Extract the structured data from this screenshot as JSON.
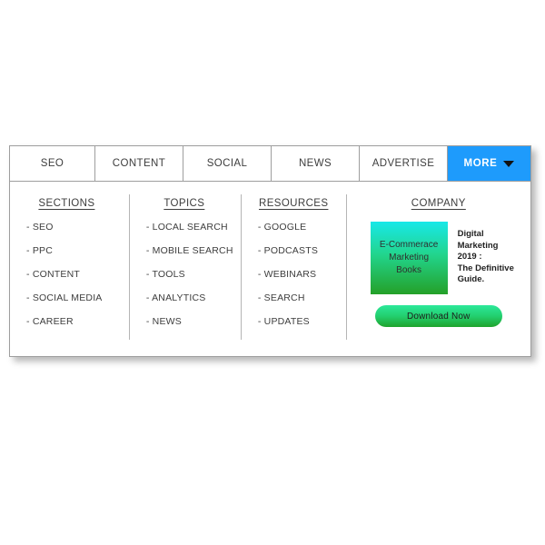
{
  "navbar": {
    "tabs": [
      {
        "label": "SEO"
      },
      {
        "label": "CONTENT"
      },
      {
        "label": "SOCIAL"
      },
      {
        "label": "NEWS"
      },
      {
        "label": "ADVERTISE"
      }
    ],
    "more": {
      "label": "MORE",
      "icon": "caret-down-icon",
      "active": true,
      "background": "#1E9BFC",
      "text_color": "#FFFFFF"
    }
  },
  "dropdown": {
    "columns": [
      {
        "title": "SECTIONS",
        "items": [
          "- SEO",
          "- PPC",
          "- CONTENT",
          "- SOCIAL MEDIA",
          "- CAREER"
        ]
      },
      {
        "title": "TOPICS",
        "items": [
          "- LOCAL SEARCH",
          "- MOBILE SEARCH",
          "- TOOLS",
          "- ANALYTICS",
          "- NEWS"
        ]
      },
      {
        "title": "RESOURCES",
        "items": [
          "- GOOGLE",
          "- PODCASTS",
          "- WEBINARS",
          "- SEARCH",
          "- UPDATES"
        ]
      }
    ],
    "company": {
      "title": "COMPANY",
      "book_cover": {
        "line1": "E-Commerace",
        "line2": "Marketing",
        "line3": "Books",
        "gradient_top": "#18E8E8",
        "gradient_bottom": "#24A028"
      },
      "description": {
        "line1": "Digital Marketing",
        "line2": "2019 :",
        "line3": "The Definitive",
        "line4": "Guide."
      },
      "download_button": {
        "label": "Download Now",
        "gradient_top": "#2CE89A",
        "gradient_bottom": "#1FA32C"
      }
    }
  }
}
